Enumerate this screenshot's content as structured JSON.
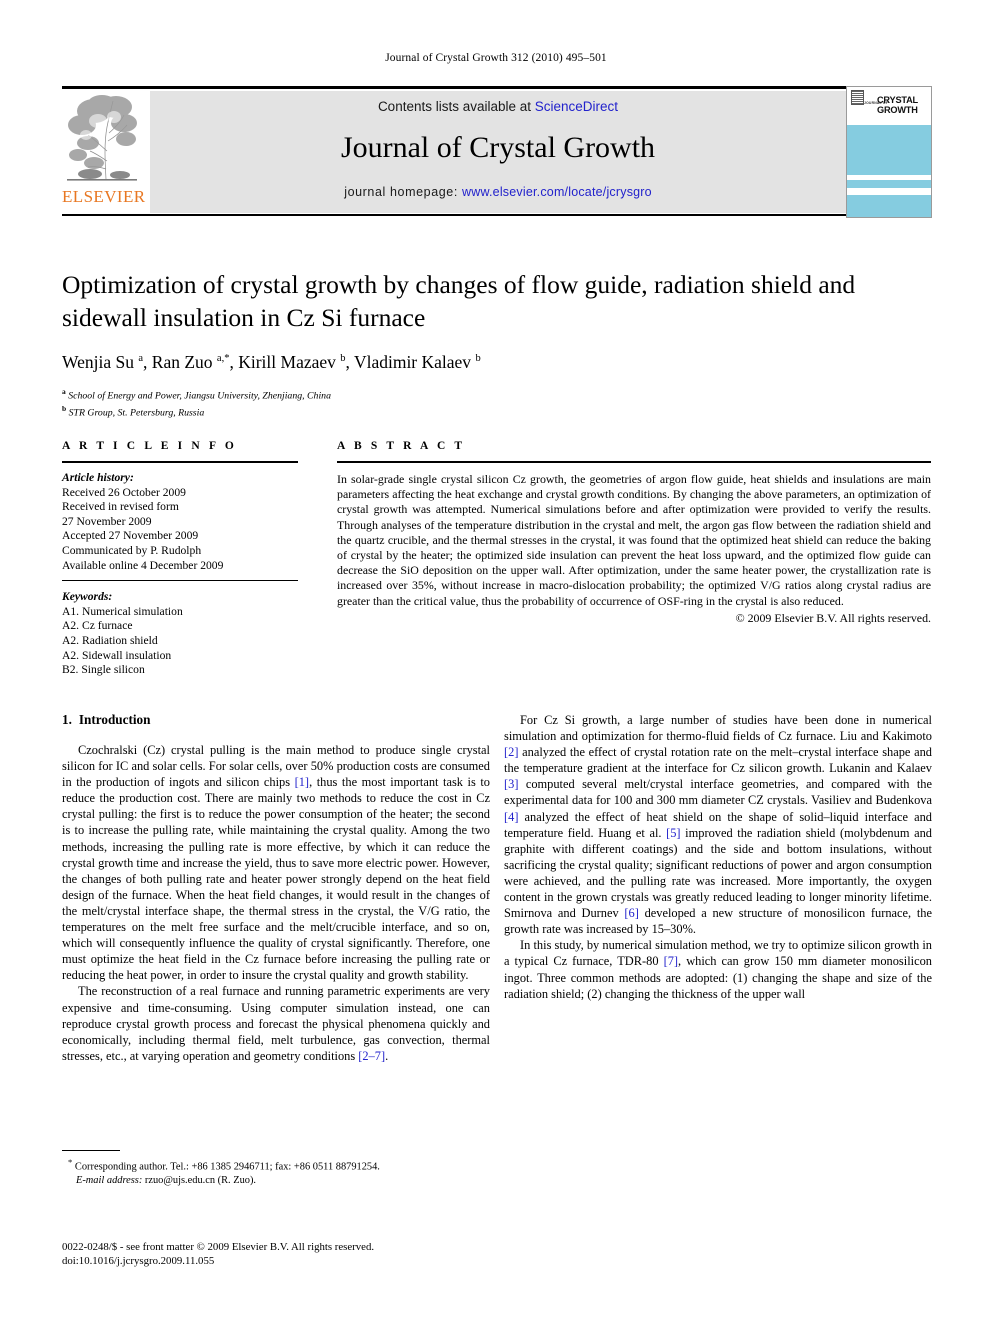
{
  "running_head": "Journal of Crystal Growth 312 (2010) 495–501",
  "masthead": {
    "contents_prefix": "Contents lists available at ",
    "sciencedirect": "ScienceDirect",
    "journal_title": "Journal of Crystal Growth",
    "homepage_prefix": "journal homepage: ",
    "homepage_url": "www.elsevier.com/locate/jcrysgro",
    "publisher": "ELSEVIER"
  },
  "cover": {
    "kicker": "JOURNAL OF",
    "title_line1": "CRYSTAL",
    "title_line2": "GROWTH",
    "band_color": "#85cce0"
  },
  "article": {
    "title": "Optimization of crystal growth by changes of flow guide, radiation shield and sidewall insulation in Cz Si furnace",
    "authors_html": "Wenjia Su <sup>a</sup>, Ran Zuo <sup>a,</sup><sup>*</sup>, Kirill Mazaev <sup>b</sup>, Vladimir Kalaev <sup>b</sup>",
    "affiliation_a": "School of Energy and Power, Jiangsu University, Zhenjiang, China",
    "affiliation_b": "STR Group, St. Petersburg, Russia"
  },
  "info": {
    "heading": "A R T I C L E   I N F O",
    "history_label": "Article history:",
    "history": [
      "Received 26 October 2009",
      "Received in revised form",
      "27 November 2009",
      "Accepted 27 November 2009",
      "Communicated by P. Rudolph",
      "Available online 4 December 2009"
    ],
    "keywords_label": "Keywords:",
    "keywords": [
      "A1. Numerical simulation",
      "A2. Cz furnace",
      "A2. Radiation shield",
      "A2. Sidewall insulation",
      "B2. Single silicon"
    ]
  },
  "abstract": {
    "heading": "A B S T R A C T",
    "text": "In solar-grade single crystal silicon Cz growth, the geometries of argon flow guide, heat shields and insulations are main parameters affecting the heat exchange and crystal growth conditions. By changing the above parameters, an optimization of crystal growth was attempted. Numerical simulations before and after optimization were provided to verify the results. Through analyses of the temperature distribution in the crystal and melt, the argon gas flow between the radiation shield and the quartz crucible, and the thermal stresses in the crystal, it was found that the optimized heat shield can reduce the baking of crystal by the heater; the optimized side insulation can prevent the heat loss upward, and the optimized flow guide can decrease the SiO deposition on the upper wall. After optimization, under the same heater power, the crystallization rate is increased over 35%, without increase in macro-dislocation probability; the optimized V/G ratios along crystal radius are greater than the critical value, thus the probability of occurrence of OSF-ring in the crystal is also reduced.",
    "copyright": "© 2009 Elsevier B.V. All rights reserved."
  },
  "section1": {
    "number": "1.",
    "heading": "Introduction",
    "p1_a": "Czochralski (Cz) crystal pulling is the main method to produce single crystal silicon for IC and solar cells. For solar cells, over 50% production costs are consumed in the production of ingots and silicon chips ",
    "p1_ref": "[1]",
    "p1_b": ", thus the most important task is to reduce the production cost. There are mainly two methods to reduce the cost in Cz crystal pulling: the first is to reduce the power consumption of the heater; the second is to increase the pulling rate, while maintaining the crystal quality. Among the two methods, increasing the pulling rate is more effective, by which it can reduce the crystal growth time and increase the yield, thus to save more electric power. However, the changes of both pulling rate and heater power strongly depend on the heat field design of the furnace. When the heat field changes, it would result in the changes of the melt/crystal interface shape, the thermal stress in the crystal, the V/G ratio, the temperatures on the melt free surface and the melt/crucible interface, and so on, which will consequently influence the quality of crystal significantly. Therefore, one must optimize the heat field in the Cz furnace before increasing the pulling rate or reducing the heat power, in order to insure the crystal quality and growth stability.",
    "p2_a": "The reconstruction of a real furnace and running parametric experiments are very expensive and time-consuming. Using computer simulation instead, one can reproduce crystal growth process and forecast the physical phenomena quickly and economically, including thermal field, melt turbulence, gas convection, thermal stresses, etc., at varying operation and geometry conditions ",
    "p2_ref": "[2–7]",
    "p2_b": ".",
    "p3_a": "For Cz Si growth, a large number of studies have been done in numerical simulation and optimization for thermo-fluid fields of Cz furnace. Liu and Kakimoto ",
    "p3_r1": "[2]",
    "p3_b": " analyzed the effect of crystal rotation rate on the melt–crystal interface shape and the temperature gradient at the interface for Cz silicon growth. Lukanin and Kalaev ",
    "p3_r2": "[3]",
    "p3_c": " computed several melt/crystal interface geometries, and compared with the experimental data for 100 and 300 mm diameter CZ crystals. Vasiliev and Budenkova ",
    "p3_r3": "[4]",
    "p3_d": " analyzed the effect of heat shield on the shape of solid–liquid interface and temperature field. Huang et al. ",
    "p3_r4": "[5]",
    "p3_e": " improved the radiation shield (molybdenum and graphite with different coatings) and the side and bottom insulations, without sacrificing the crystal quality; significant reductions of power and argon consumption were achieved, and the pulling rate was increased. More importantly, the oxygen content in the grown crystals was greatly reduced leading to longer minority lifetime. Smirnova and Durnev ",
    "p3_r5": "[6]",
    "p3_f": " developed a new structure of monosilicon furnace, the growth rate was increased by 15–30%.",
    "p4_a": "In this study, by numerical simulation method, we try to optimize silicon growth in a typical Cz furnace, TDR-80 ",
    "p4_r1": "[7]",
    "p4_b": ", which can grow 150 mm diameter monosilicon ingot. Three common methods are adopted: (1) changing the shape and size of the radiation shield; (2) changing the thickness of the upper wall"
  },
  "footnote": {
    "marker": "*",
    "line1": " Corresponding author. Tel.: +86 1385 2946711; fax: +86 0511 88791254.",
    "email_label": "E-mail address:",
    "email_value": " rzuo@ujs.edu.cn (R. Zuo)."
  },
  "frontmatter": {
    "line1": "0022-0248/$ - see front matter © 2009 Elsevier B.V. All rights reserved.",
    "line2": "doi:10.1016/j.jcrysgro.2009.11.055"
  }
}
